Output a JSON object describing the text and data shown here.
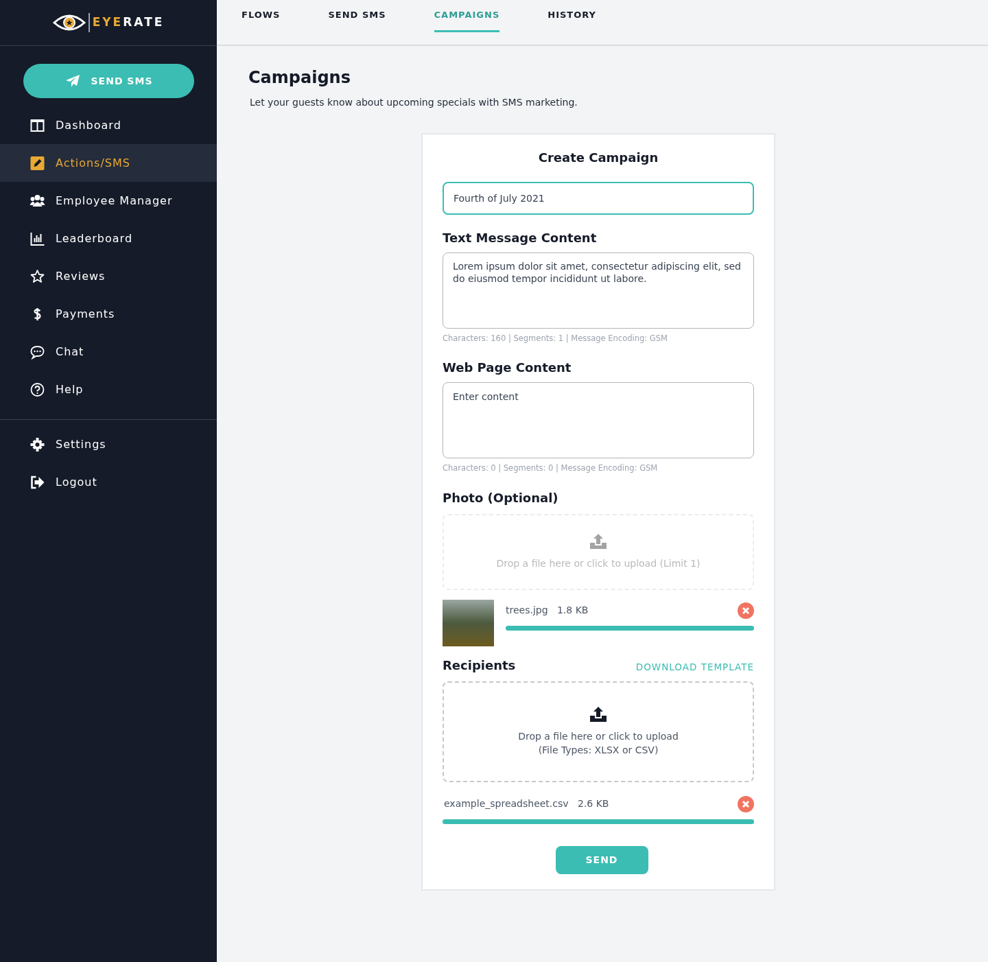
{
  "logo": {
    "parts": [
      {
        "text": "EYE",
        "color": "#e9a935"
      },
      {
        "text": "RATE",
        "color": "#ffffff"
      }
    ]
  },
  "sidebar": {
    "cta": "SEND SMS",
    "items": [
      {
        "kind": "dashboard",
        "label": "Dashboard",
        "selected": false
      },
      {
        "kind": "actions",
        "label": "Actions/SMS",
        "selected": true
      },
      {
        "kind": "employees",
        "label": "Employee Manager",
        "selected": false
      },
      {
        "kind": "leaderboard",
        "label": "Leaderboard",
        "selected": false
      },
      {
        "kind": "reviews",
        "label": "Reviews",
        "selected": false
      },
      {
        "kind": "payments",
        "label": "Payments",
        "selected": false
      },
      {
        "kind": "chat",
        "label": "Chat",
        "selected": false
      },
      {
        "kind": "help",
        "label": "Help",
        "selected": false
      }
    ],
    "bottom_items": [
      {
        "kind": "settings",
        "label": "Settings",
        "selected": false
      },
      {
        "kind": "logout",
        "label": "Logout",
        "selected": false
      }
    ]
  },
  "tabs": [
    {
      "label": "FLOWS",
      "selected": false
    },
    {
      "label": "SEND SMS",
      "selected": false
    },
    {
      "label": "CAMPAIGNS",
      "selected": true
    },
    {
      "label": "HISTORY",
      "selected": false
    }
  ],
  "page": {
    "title": "Campaigns",
    "subtitle": "Let your guests know about upcoming specials with SMS marketing."
  },
  "form": {
    "title": "Create Campaign",
    "name_field": {
      "value": "Fourth of July 2021"
    },
    "sms": {
      "label": "Text Message Content",
      "value": "Lorem ipsum dolor sit amet, consectetur adipiscing elit, sed do eiusmod tempor incididunt ut labore.",
      "stats": "Characters: 160 | Segments: 1 | Message Encoding: GSM"
    },
    "web": {
      "label": "Web Page Content",
      "placeholder": "Enter content",
      "stats": "Characters: 0 | Segments: 0 | Message Encoding: GSM"
    },
    "photo": {
      "label": "Photo (Optional)",
      "dropzone": "Drop a file here or click to upload (Limit 1)",
      "disabled": true,
      "file": {
        "name": "trees.jpg",
        "size": "1.8 KB",
        "level": 1
      }
    },
    "recipients": {
      "label": "Recipients",
      "link": "DOWNLOAD TEMPLATE",
      "dropzone_lines": [
        "Drop a file here or click to upload",
        "(File Types: XLSX or CSV)"
      ],
      "disabled": false,
      "file": {
        "name": "example_spreadsheet.csv",
        "size": "2.6 KB",
        "level": 1
      }
    },
    "submit": "SEND"
  }
}
